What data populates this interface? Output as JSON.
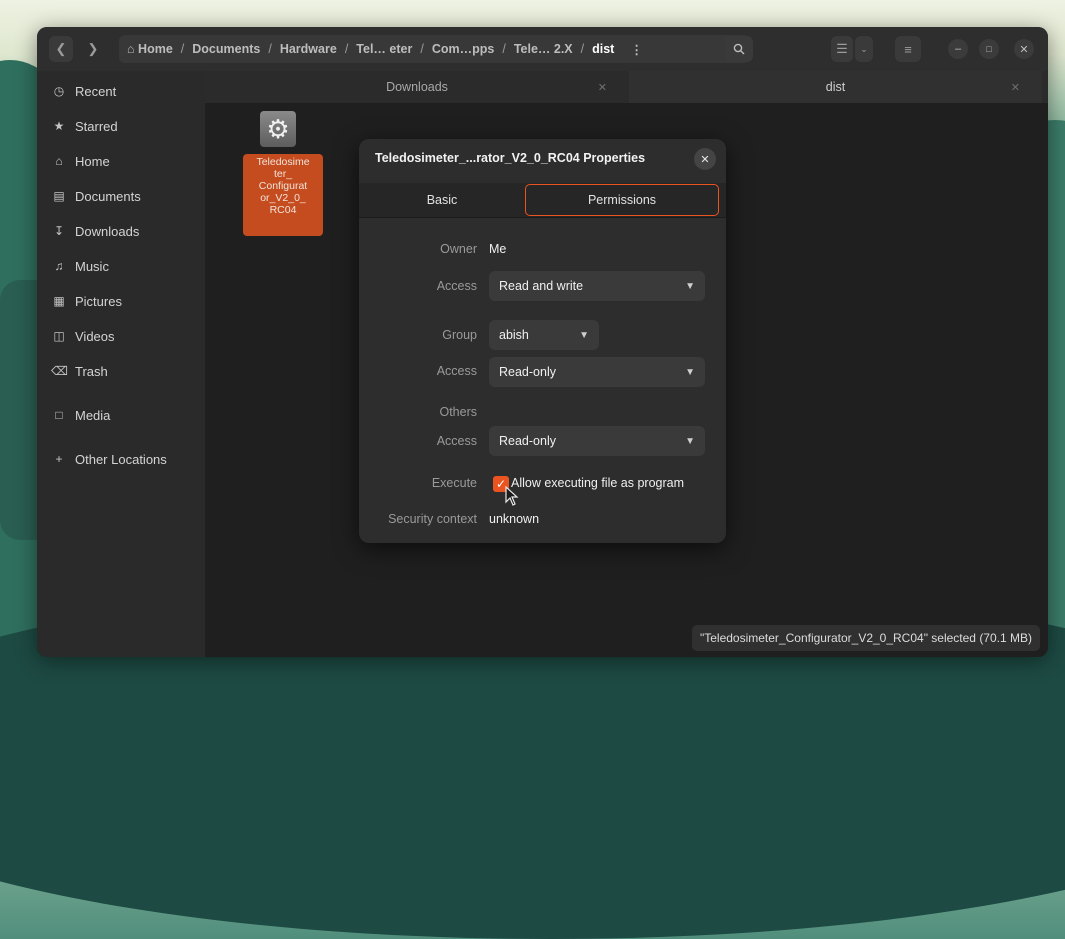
{
  "window": {
    "path": [
      {
        "label": "Home",
        "icon": "home-icon"
      },
      {
        "label": "Documents"
      },
      {
        "label": "Hardware"
      },
      {
        "label": "Tel… eter"
      },
      {
        "label": "Com…pps"
      },
      {
        "label": "Tele… 2.X"
      },
      {
        "label": "dist",
        "current": true
      }
    ]
  },
  "sidebar": {
    "items": [
      {
        "label": "Recent",
        "icon": "clock-icon"
      },
      {
        "label": "Starred",
        "icon": "star-icon"
      },
      {
        "label": "Home",
        "icon": "home-icon"
      },
      {
        "label": "Documents",
        "icon": "document-icon"
      },
      {
        "label": "Downloads",
        "icon": "download-icon"
      },
      {
        "label": "Music",
        "icon": "music-icon"
      },
      {
        "label": "Pictures",
        "icon": "picture-icon"
      },
      {
        "label": "Videos",
        "icon": "video-icon"
      },
      {
        "label": "Trash",
        "icon": "trash-icon"
      },
      {
        "label": "Media",
        "icon": "folder-icon"
      },
      {
        "label": "Other Locations",
        "icon": "plus-icon"
      }
    ]
  },
  "tabs": [
    {
      "label": "Downloads",
      "active": false
    },
    {
      "label": "dist",
      "active": true
    }
  ],
  "file": {
    "name_lines": [
      "Teledosime",
      "ter_",
      "Configurat",
      "or_V2_0_",
      "RC04"
    ],
    "icon": "gear-icon"
  },
  "status": "\"Teledosimeter_Configurator_V2_0_RC04\" selected (70.1 MB)",
  "dialog": {
    "title": "Teledosimeter_...rator_V2_0_RC04 Properties",
    "tabs": {
      "basic": "Basic",
      "permissions": "Permissions"
    },
    "owner_label": "Owner",
    "owner_value": "Me",
    "access_label": "Access",
    "owner_access": "Read and write",
    "group_label": "Group",
    "group_value": "abish",
    "group_access": "Read-only",
    "others_label": "Others",
    "others_access": "Read-only",
    "execute_label": "Execute",
    "execute_checkbox": "Allow executing file as program",
    "execute_checked": true,
    "security_label": "Security context",
    "security_value": "unknown"
  },
  "colors": {
    "accent": "#e95420",
    "window_bg": "#242424",
    "sidebar_bg": "#2a2a2a"
  }
}
